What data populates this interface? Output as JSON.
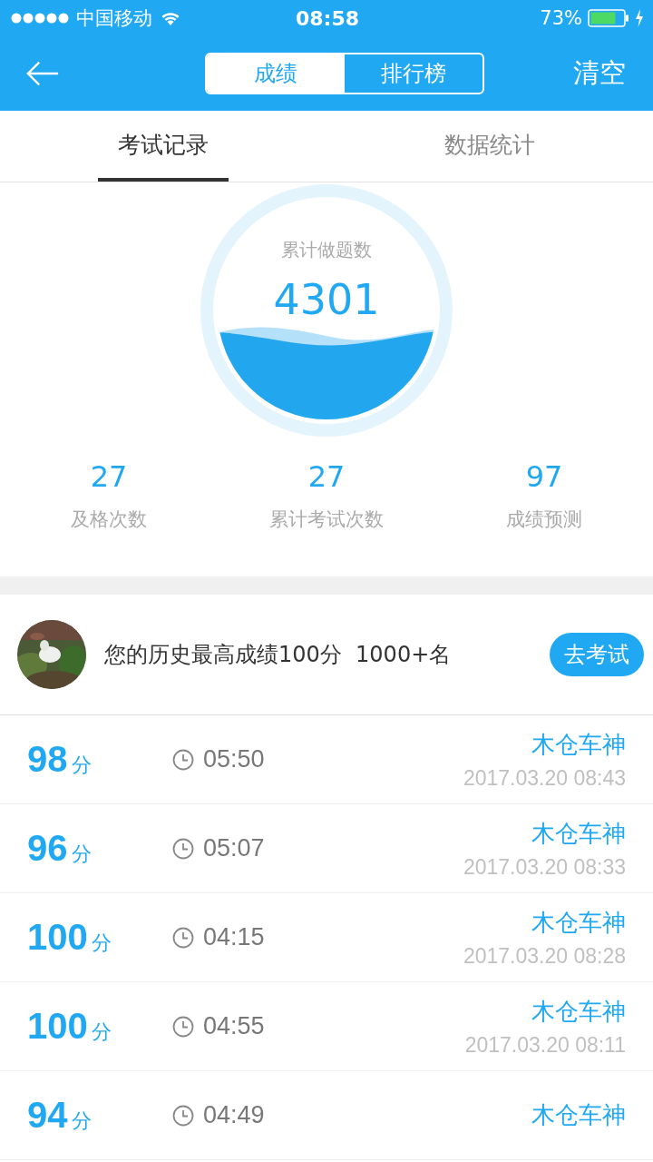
{
  "status_bar": {
    "carrier": "中国移动",
    "time": "08:58",
    "battery": "73%"
  },
  "nav": {
    "segments": [
      {
        "label": "成绩",
        "selected": true
      },
      {
        "label": "排行榜",
        "selected": false
      }
    ],
    "action": "清空"
  },
  "tabs": [
    {
      "label": "考试记录",
      "selected": true
    },
    {
      "label": "数据统计",
      "selected": false
    }
  ],
  "summary": {
    "label": "累计做题数",
    "value": "4301"
  },
  "stats": [
    {
      "value": "27",
      "label": "及格次数"
    },
    {
      "value": "27",
      "label": "累计考试次数"
    },
    {
      "value": "97",
      "label": "成绩预测"
    }
  ],
  "best": {
    "text": "您的历史最高成绩100分  1000+名",
    "button": "去考试"
  },
  "records": [
    {
      "score": "98",
      "unit": "分",
      "duration": "05:50",
      "name": "木仓车神",
      "date": "2017.03.20 08:43"
    },
    {
      "score": "96",
      "unit": "分",
      "duration": "05:07",
      "name": "木仓车神",
      "date": "2017.03.20 08:33"
    },
    {
      "score": "100",
      "unit": "分",
      "duration": "04:15",
      "name": "木仓车神",
      "date": "2017.03.20 08:28"
    },
    {
      "score": "100",
      "unit": "分",
      "duration": "04:55",
      "name": "木仓车神",
      "date": "2017.03.20 08:11"
    },
    {
      "score": "94",
      "unit": "分",
      "duration": "04:49",
      "name": "木仓车神"
    }
  ]
}
